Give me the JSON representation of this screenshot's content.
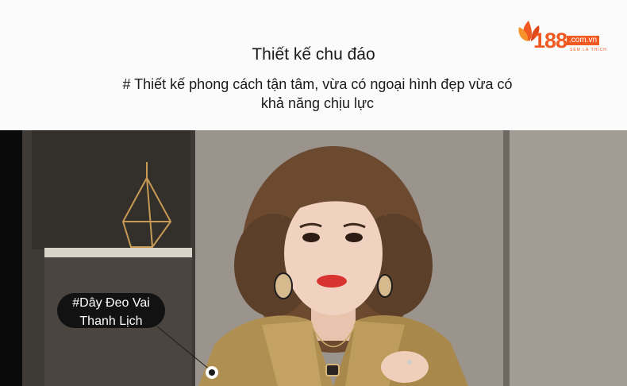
{
  "header": {
    "title": "Thiết kế chu đáo",
    "subtitle": "# Thiết kế phong cách tận tâm, vừa có ngoại hình đẹp vừa có khả năng chịu lực"
  },
  "logo": {
    "main": "188",
    "domain": ".com.vn",
    "tagline": "SẺM LÀ THÍCH"
  },
  "callout": {
    "line1": "#Dây Đeo Vai",
    "line2": "Thanh Lịch"
  },
  "colors": {
    "brand": "#f05a22",
    "callout_bg": "#121212",
    "text": "#1a1a1a"
  }
}
